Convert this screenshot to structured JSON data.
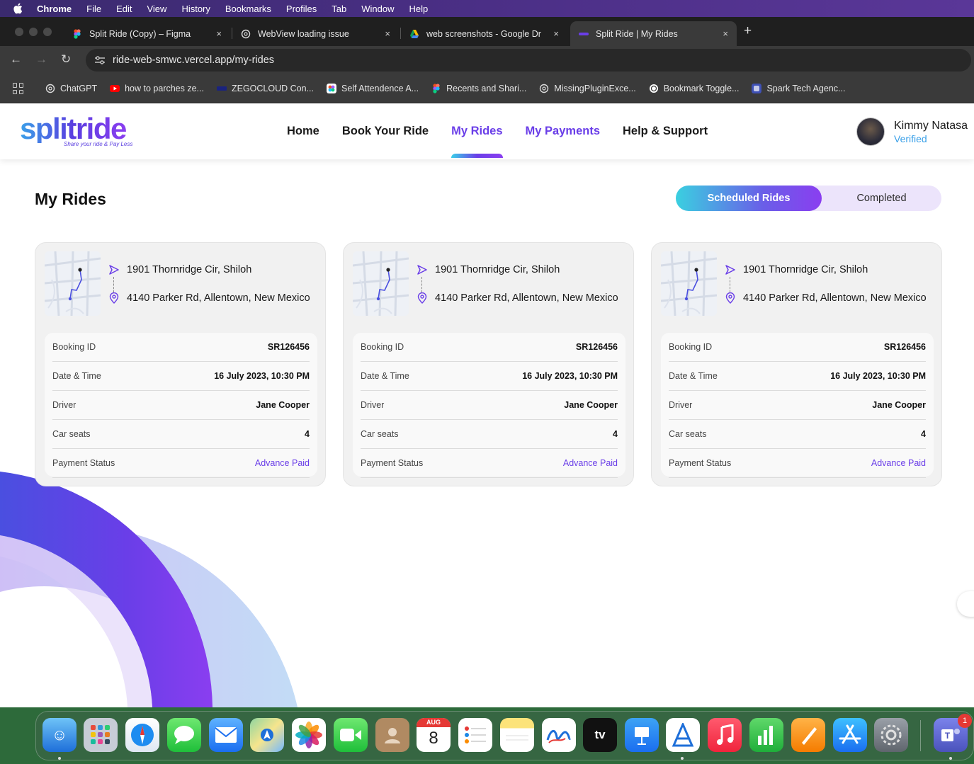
{
  "menubar": {
    "app": "Chrome",
    "items": [
      "File",
      "Edit",
      "View",
      "History",
      "Bookmarks",
      "Profiles",
      "Tab",
      "Window",
      "Help"
    ]
  },
  "tabs": [
    {
      "title": "Split Ride (Copy) – Figma",
      "close": "×"
    },
    {
      "title": "WebView loading issue",
      "close": "×"
    },
    {
      "title": "web screenshots - Google Dr",
      "close": "×"
    },
    {
      "title": "Split Ride | My Rides",
      "close": "×"
    }
  ],
  "new_tab": "+",
  "toolbar": {
    "back": "←",
    "forward": "→",
    "reload": "↻",
    "url": "ride-web-smwc.vercel.app/my-rides"
  },
  "bookmarks": [
    {
      "label": "ChatGPT"
    },
    {
      "label": "how to parches ze..."
    },
    {
      "label": "ZEGOCLOUD Con..."
    },
    {
      "label": "Self Attendence A..."
    },
    {
      "label": "Recents and Shari..."
    },
    {
      "label": "MissingPluginExce..."
    },
    {
      "label": "Bookmark Toggle..."
    },
    {
      "label": "Spark Tech Agenc..."
    }
  ],
  "site": {
    "logo": "splitride",
    "tagline": "Share your ride & Pay Less",
    "nav": [
      "Home",
      "Book Your Ride",
      "My Rides",
      "My Payments",
      "Help & Support"
    ],
    "user": {
      "name": "Kimmy Natasa",
      "status": "Verified"
    }
  },
  "page": {
    "title": "My Rides",
    "toggle": {
      "scheduled": "Scheduled Rides",
      "completed": "Completed"
    }
  },
  "rides": [
    {
      "pickup": "1901 Thornridge Cir, Shiloh",
      "dropoff": "4140 Parker Rd, Allentown, New Mexico",
      "details": [
        {
          "label": "Booking ID",
          "value": "SR126456"
        },
        {
          "label": "Date & Time",
          "value": "16 July 2023, 10:30 PM"
        },
        {
          "label": "Driver",
          "value": "Jane Cooper"
        },
        {
          "label": "Car seats",
          "value": "4"
        },
        {
          "label": "Payment Status",
          "value": "Advance Paid"
        }
      ]
    },
    {
      "pickup": "1901 Thornridge Cir, Shiloh",
      "dropoff": "4140 Parker Rd, Allentown, New Mexico",
      "details": [
        {
          "label": "Booking ID",
          "value": "SR126456"
        },
        {
          "label": "Date & Time",
          "value": "16 July 2023, 10:30 PM"
        },
        {
          "label": "Driver",
          "value": "Jane Cooper"
        },
        {
          "label": "Car seats",
          "value": "4"
        },
        {
          "label": "Payment Status",
          "value": "Advance Paid"
        }
      ]
    },
    {
      "pickup": "1901 Thornridge Cir, Shiloh",
      "dropoff": "4140 Parker Rd, Allentown, New Mexico",
      "details": [
        {
          "label": "Booking ID",
          "value": "SR126456"
        },
        {
          "label": "Date & Time",
          "value": "16 July 2023, 10:30 PM"
        },
        {
          "label": "Driver",
          "value": "Jane Cooper"
        },
        {
          "label": "Car seats",
          "value": "4"
        },
        {
          "label": "Payment Status",
          "value": "Advance Paid"
        }
      ]
    }
  ],
  "dock": {
    "calendar_month": "AUG",
    "calendar_day": "8",
    "tv_label": "tv",
    "teams_badge": "1"
  },
  "colors": {
    "accent": "#6a3ee8",
    "verified": "#3aa0e8",
    "toggle_bg": "#ece4fb"
  }
}
